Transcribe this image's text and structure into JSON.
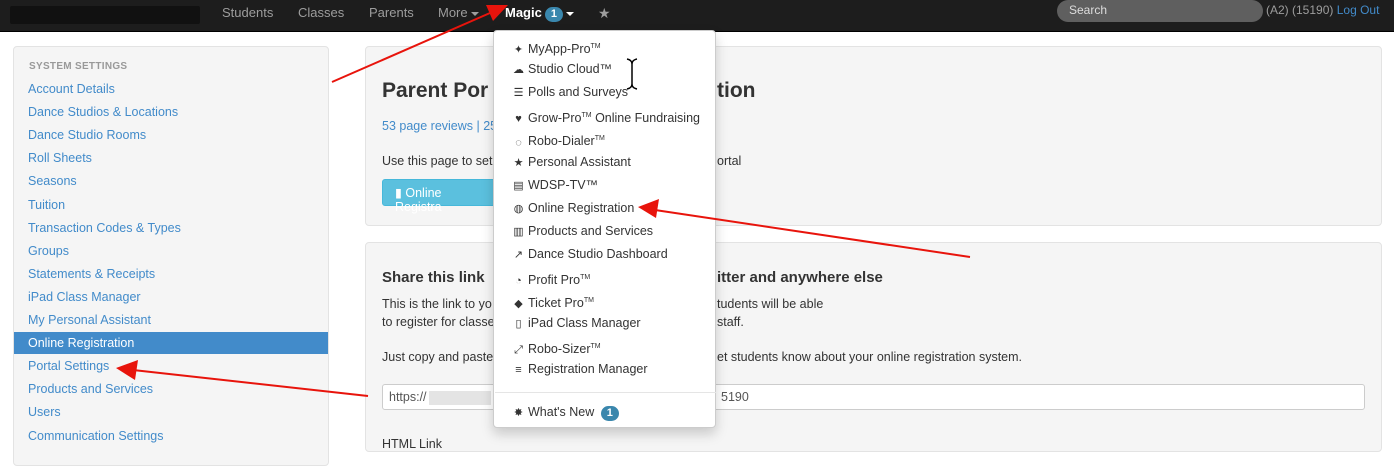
{
  "nav": {
    "items": [
      {
        "label": "Students"
      },
      {
        "label": "Classes"
      },
      {
        "label": "Parents"
      },
      {
        "label": "More"
      },
      {
        "label": "Magic",
        "badge": "1"
      }
    ],
    "search_placeholder": "Search",
    "user_info": "(A2) (15190)",
    "logout_label": "Log Out"
  },
  "sidebar": {
    "heading": "SYSTEM SETTINGS",
    "items": [
      "Account Details",
      "Dance Studios & Locations",
      "Dance Studio Rooms",
      "Roll Sheets",
      "Seasons",
      "Tuition",
      "Transaction Codes & Types",
      "Groups",
      "Statements & Receipts",
      "iPad Class Manager",
      "My Personal Assistant",
      "Online Registration",
      "Portal Settings",
      "Products and Services",
      "Users",
      "Communication Settings"
    ],
    "active_index": 11
  },
  "main": {
    "title_left": "Parent Por",
    "title_right": "tion",
    "reviews_left": "53 page reviews | 25",
    "desc_left": "Use this page to set",
    "desc_right": "ortal",
    "button_label": "Online Registra",
    "share_left": "Share this link",
    "share_right": "itter and anywhere else",
    "p1_left": "This is the link to yo",
    "p1_right": "tudents will be able",
    "p2_left": "to register for classe",
    "p2_right": "staff.",
    "p3_left": "Just copy and paste",
    "p3_right": "et students know about your online registration system.",
    "url_left": "https://",
    "url_right": "5190",
    "html_label": "HTML Link"
  },
  "dropdown": {
    "items": [
      {
        "label": "MyApp-Pro",
        "tm": "TM",
        "icon": "apple-android-icon"
      },
      {
        "label": "Studio Cloud™",
        "icon": "cloud-icon"
      },
      {
        "label": "Polls and Surveys",
        "icon": "list-icon"
      },
      {
        "label": "Grow-Pro",
        "tm": "TM",
        "suffix": " Online Fundraising",
        "icon": "heart-icon"
      },
      {
        "label": "Robo-Dialer",
        "tm": "TM",
        "icon": "chat-icon"
      },
      {
        "label": "Personal Assistant",
        "icon": "star-icon"
      },
      {
        "label": "WDSP-TV™",
        "icon": "film-icon"
      },
      {
        "label": "Online Registration",
        "icon": "globe-icon"
      },
      {
        "label": "Products and Services",
        "icon": "barcode-icon"
      },
      {
        "label": "Dance Studio Dashboard",
        "icon": "chart-icon"
      },
      {
        "label": "Profit Pro",
        "tm": "TM",
        "icon": "pie-icon"
      },
      {
        "label": "Ticket Pro",
        "tm": "TM",
        "icon": "tag-icon"
      },
      {
        "label": "iPad Class Manager",
        "icon": "tablet-icon"
      },
      {
        "label": "Robo-Sizer",
        "tm": "TM",
        "icon": "resize-icon"
      },
      {
        "label": "Registration Manager",
        "icon": "stack-icon"
      }
    ],
    "whats_new": "What's New",
    "whats_new_badge": "1"
  },
  "colors": {
    "accent": "#428bca",
    "annotation": "#e8140c"
  }
}
